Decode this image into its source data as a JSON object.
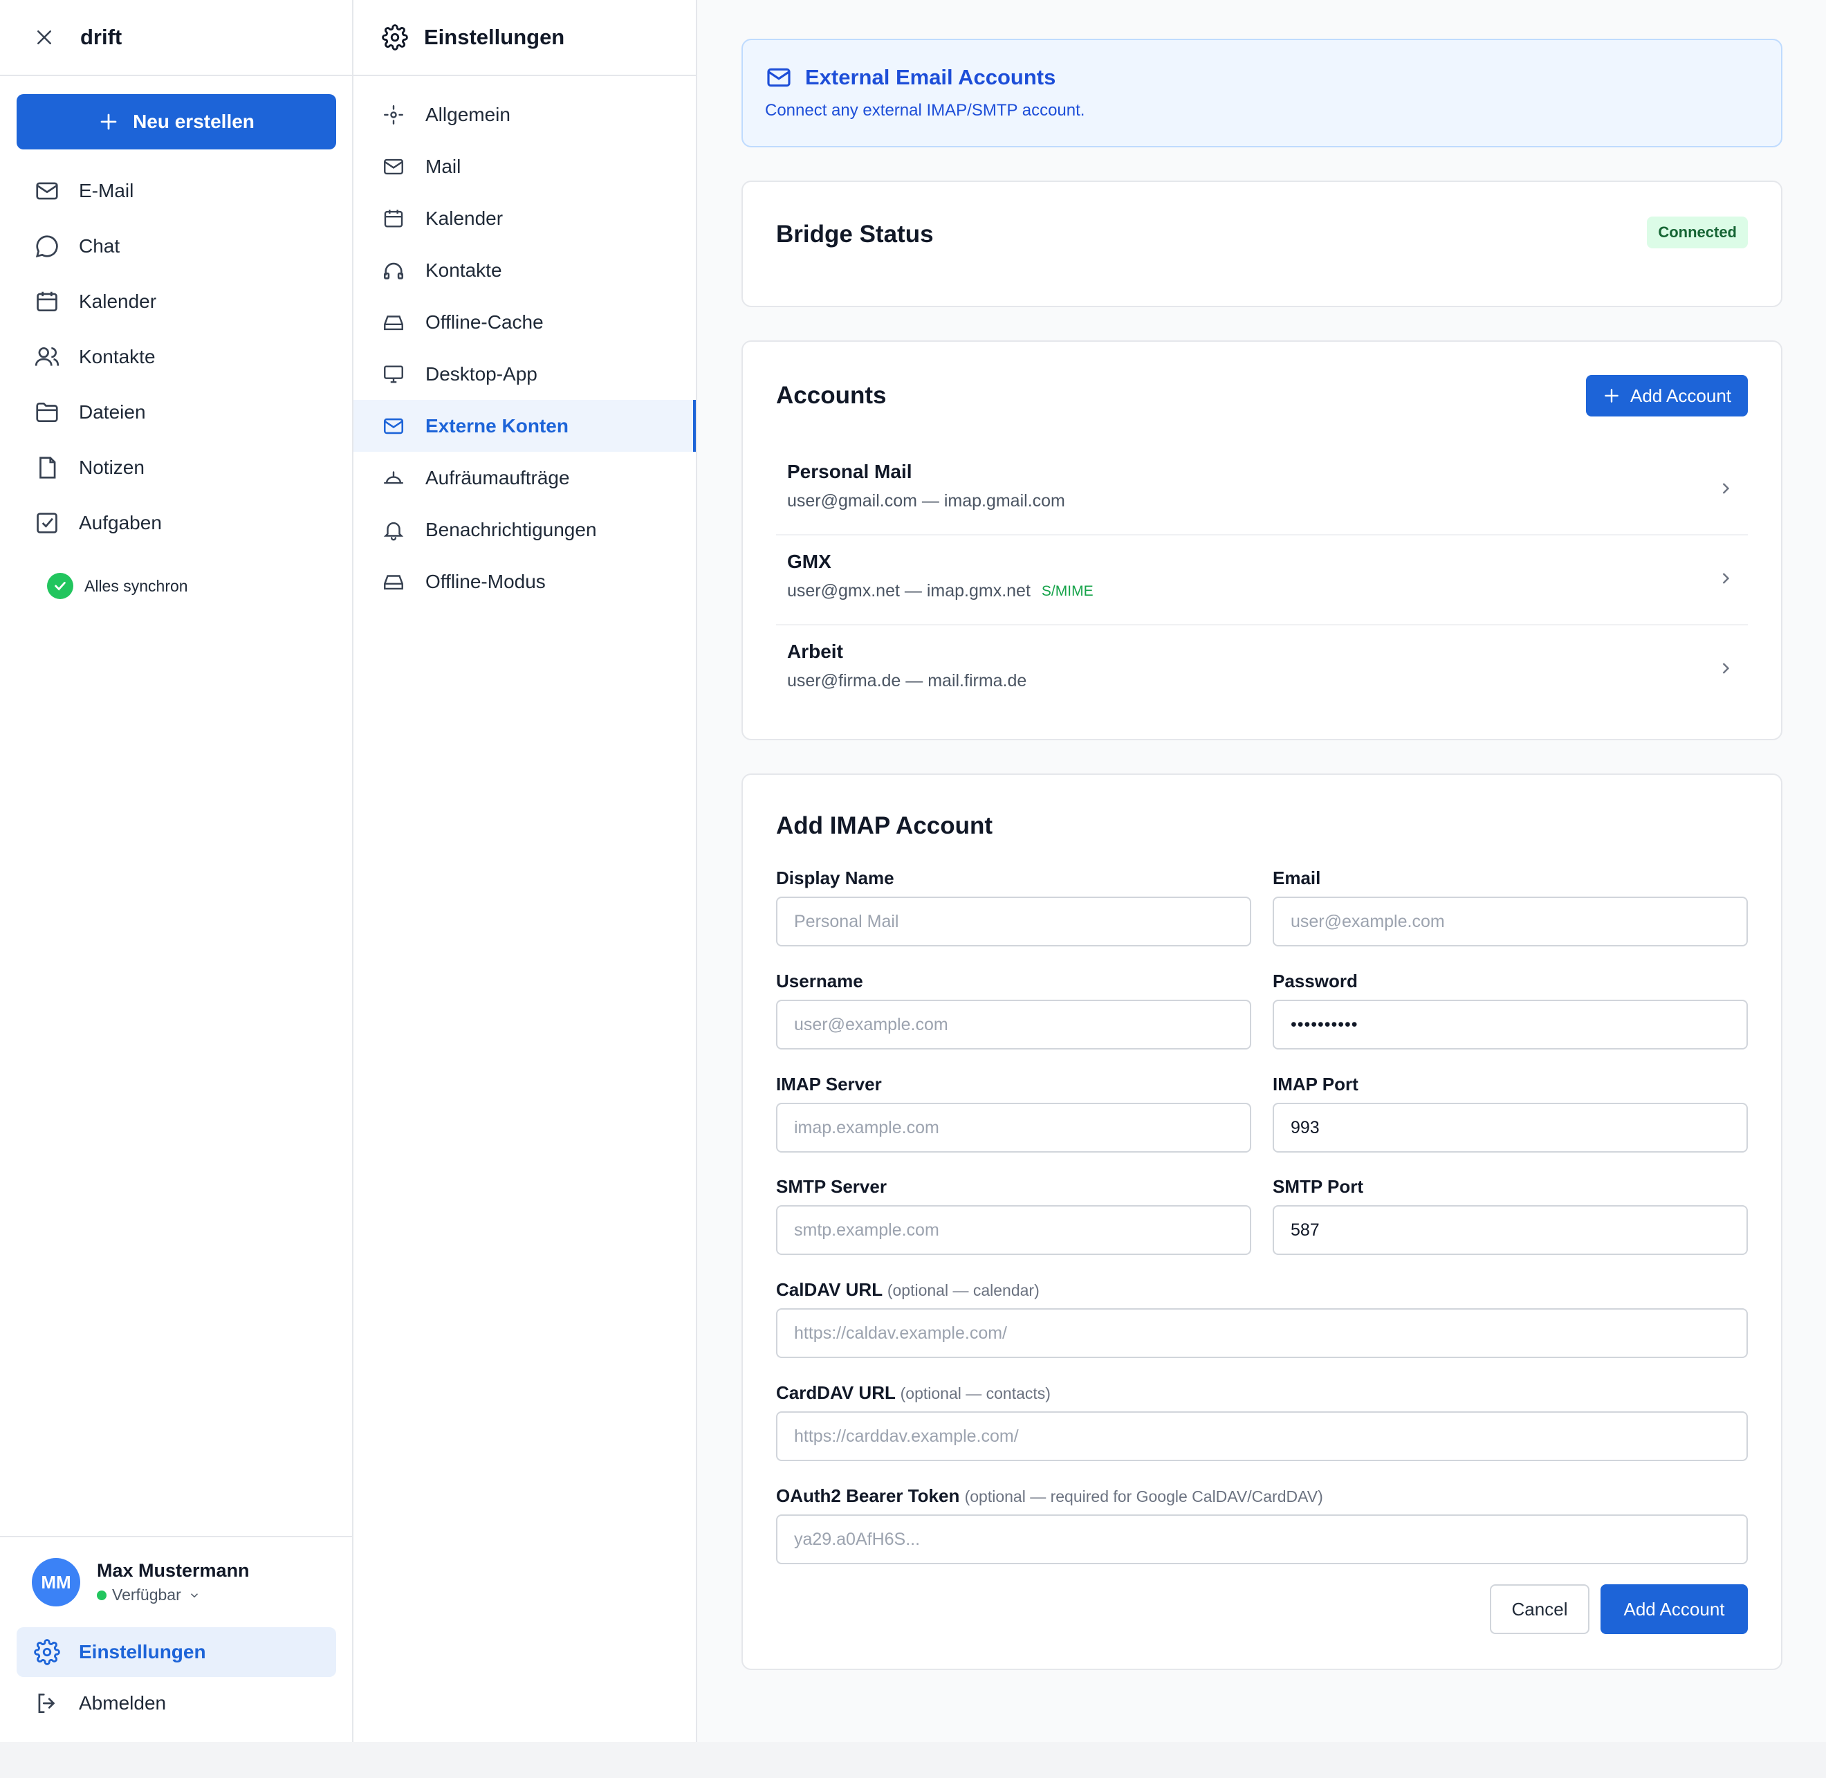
{
  "app": {
    "brand": "drift"
  },
  "sidebar": {
    "new_button": "Neu erstellen",
    "items": [
      {
        "label": "E-Mail",
        "icon": "mail-icon"
      },
      {
        "label": "Chat",
        "icon": "chat-icon"
      },
      {
        "label": "Kalender",
        "icon": "calendar-icon"
      },
      {
        "label": "Kontakte",
        "icon": "users-icon"
      },
      {
        "label": "Dateien",
        "icon": "folder-icon"
      },
      {
        "label": "Notizen",
        "icon": "note-icon"
      },
      {
        "label": "Aufgaben",
        "icon": "checkbox-icon"
      }
    ],
    "sync_status": "Alles synchron",
    "user": {
      "initials": "MM",
      "name": "Max Mustermann",
      "status": "Verfügbar"
    },
    "settings_label": "Einstellungen",
    "logout_label": "Abmelden"
  },
  "settings_nav": {
    "title": "Einstellungen",
    "items": [
      {
        "label": "Allgemein",
        "icon": "general-icon"
      },
      {
        "label": "Mail",
        "icon": "mail-icon"
      },
      {
        "label": "Kalender",
        "icon": "calendar-icon"
      },
      {
        "label": "Kontakte",
        "icon": "headphones-icon"
      },
      {
        "label": "Offline-Cache",
        "icon": "drive-icon"
      },
      {
        "label": "Desktop-App",
        "icon": "monitor-icon"
      },
      {
        "label": "Externe Konten",
        "icon": "mail-icon",
        "active": true
      },
      {
        "label": "Aufräumaufträge",
        "icon": "sweep-icon"
      },
      {
        "label": "Benachrichtigungen",
        "icon": "bell-icon"
      },
      {
        "label": "Offline-Modus",
        "icon": "drive-icon"
      }
    ]
  },
  "banner": {
    "title": "External Email Accounts",
    "subtitle": "Connect any external IMAP/SMTP account."
  },
  "bridge": {
    "title": "Bridge Status",
    "status": "Connected"
  },
  "accounts": {
    "title": "Accounts",
    "add_button": "Add Account",
    "list": [
      {
        "name": "Personal Mail",
        "detail": "user@gmail.com — imap.gmail.com",
        "tag": ""
      },
      {
        "name": "GMX",
        "detail": "user@gmx.net — imap.gmx.net",
        "tag": "S/MIME"
      },
      {
        "name": "Arbeit",
        "detail": "user@firma.de — mail.firma.de",
        "tag": ""
      }
    ]
  },
  "form": {
    "title": "Add IMAP Account",
    "display_name": {
      "label": "Display Name",
      "placeholder": "Personal Mail"
    },
    "email": {
      "label": "Email",
      "placeholder": "user@example.com"
    },
    "username": {
      "label": "Username",
      "placeholder": "user@example.com"
    },
    "password": {
      "label": "Password",
      "value": "••••••••••"
    },
    "imap_server": {
      "label": "IMAP Server",
      "placeholder": "imap.example.com"
    },
    "imap_port": {
      "label": "IMAP Port",
      "value": "993"
    },
    "smtp_server": {
      "label": "SMTP Server",
      "placeholder": "smtp.example.com"
    },
    "smtp_port": {
      "label": "SMTP Port",
      "value": "587"
    },
    "caldav": {
      "label": "CalDAV URL",
      "hint": "(optional — calendar)",
      "placeholder": "https://caldav.example.com/"
    },
    "carddav": {
      "label": "CardDAV URL",
      "hint": "(optional — contacts)",
      "placeholder": "https://carddav.example.com/"
    },
    "oauth": {
      "label": "OAuth2 Bearer Token",
      "hint": "(optional — required for Google CalDAV/CardDAV)",
      "placeholder": "ya29.a0AfH6S..."
    },
    "cancel": "Cancel",
    "submit": "Add Account"
  },
  "colors": {
    "accent": "#1d64d8",
    "success": "#22c55e",
    "banner_bg": "#eff6ff"
  }
}
